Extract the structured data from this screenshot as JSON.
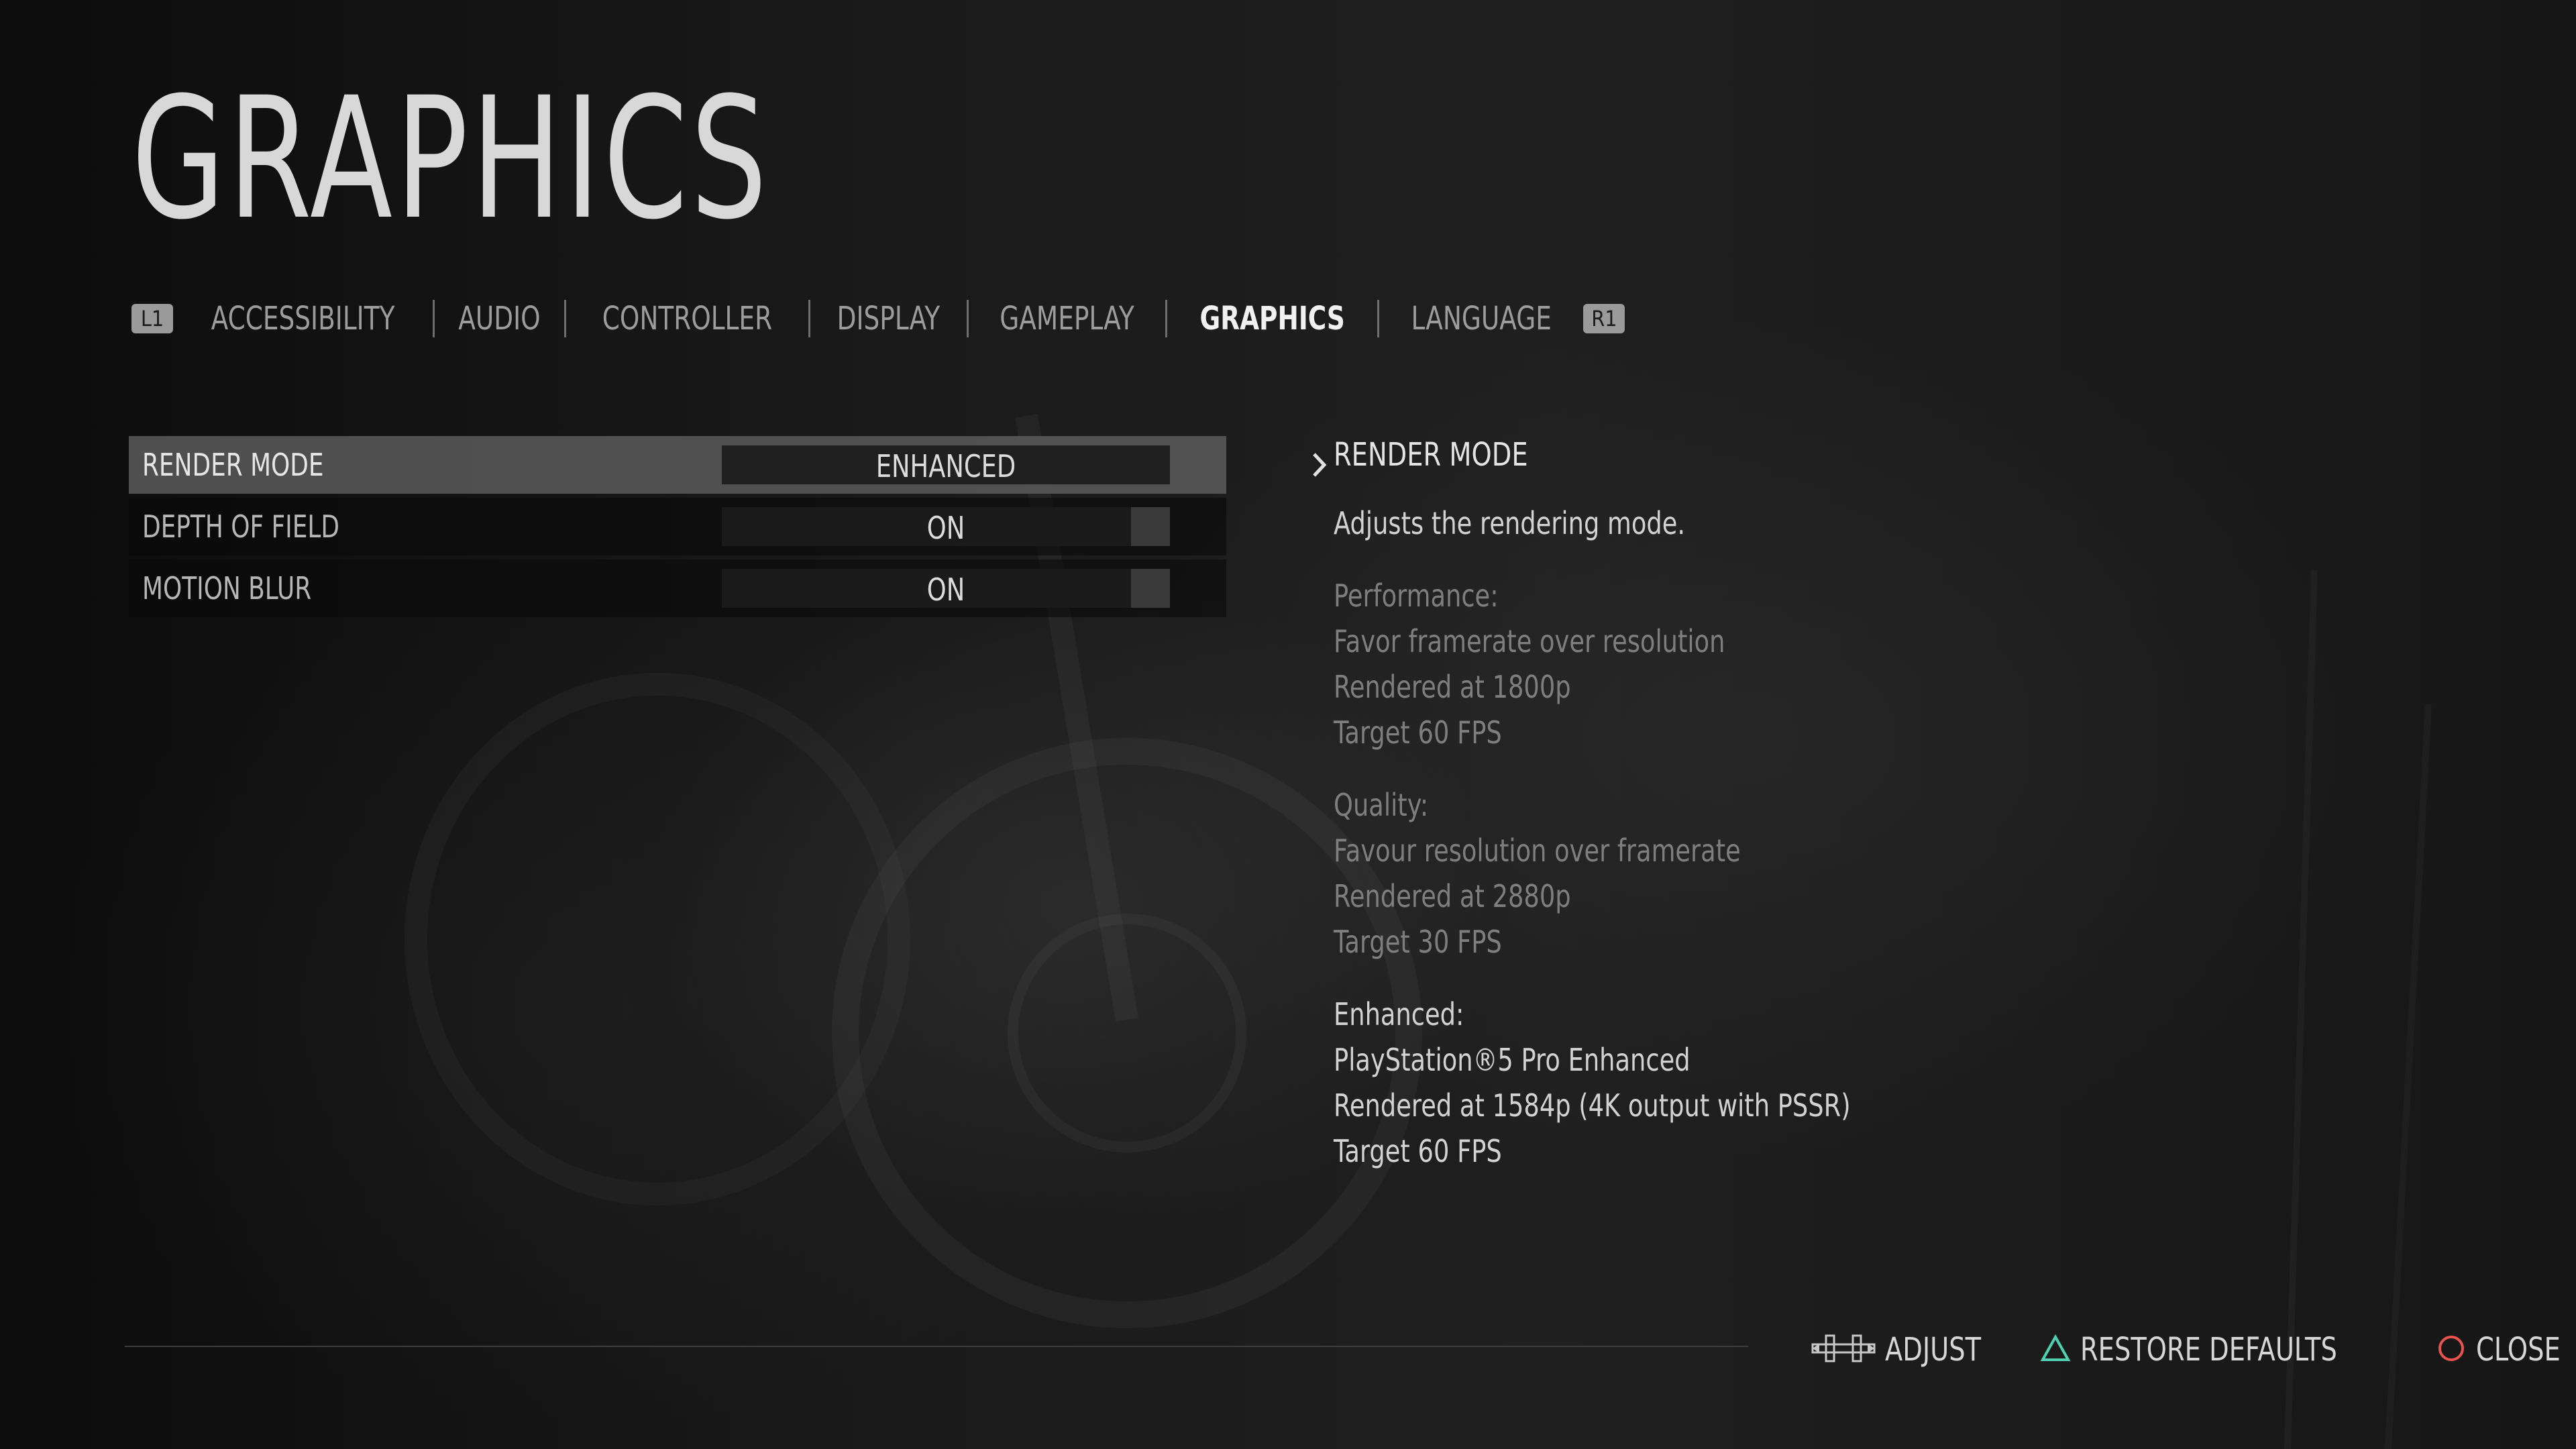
{
  "page": {
    "title": "GRAPHICS"
  },
  "tabs": {
    "left_button": "L1",
    "right_button": "R1",
    "items": [
      {
        "label": "ACCESSIBILITY",
        "active": false
      },
      {
        "label": "AUDIO",
        "active": false
      },
      {
        "label": "CONTROLLER",
        "active": false
      },
      {
        "label": "DISPLAY",
        "active": false
      },
      {
        "label": "GAMEPLAY",
        "active": false
      },
      {
        "label": "GRAPHICS",
        "active": true
      },
      {
        "label": "LANGUAGE",
        "active": false
      }
    ]
  },
  "settings": [
    {
      "label": "RENDER MODE",
      "value": "ENHANCED",
      "selected": true,
      "type": "selector"
    },
    {
      "label": "DEPTH OF FIELD",
      "value": "ON",
      "selected": false,
      "type": "toggle"
    },
    {
      "label": "MOTION BLUR",
      "value": "ON",
      "selected": false,
      "type": "toggle"
    }
  ],
  "description": {
    "title": "RENDER MODE",
    "summary": "Adjusts the rendering mode.",
    "performance": {
      "heading": "Performance:",
      "lines": [
        "Favor framerate over resolution",
        "Rendered at 1800p",
        "Target 60 FPS"
      ]
    },
    "quality": {
      "heading": "Quality:",
      "lines": [
        "Favour resolution over framerate",
        "Rendered at 2880p",
        "Target 30 FPS"
      ]
    },
    "enhanced": {
      "heading": "Enhanced:",
      "lines": [
        "PlayStation®5 Pro Enhanced",
        "Rendered at 1584p (4K output with PSSR)",
        "Target 60 FPS"
      ]
    }
  },
  "footer": {
    "adjust_label": "ADJUST",
    "restore_label": "RESTORE DEFAULTS",
    "close_label": "CLOSE",
    "icons": {
      "adjust": "dpad-left-right-icon",
      "restore": "triangle-button-icon",
      "close": "circle-button-icon"
    },
    "colors": {
      "triangle": "#4fd1b0",
      "circle": "#e8524f"
    }
  }
}
